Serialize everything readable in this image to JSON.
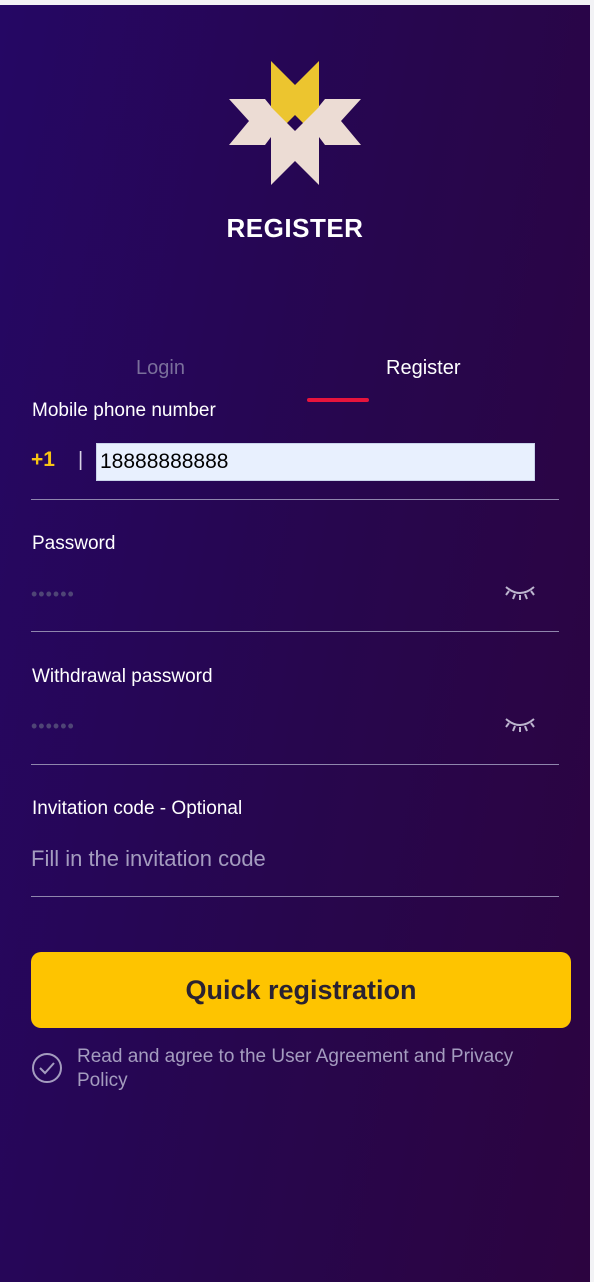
{
  "header": {
    "title": "REGISTER",
    "logo_icon": "star-burst-logo"
  },
  "tabs": [
    {
      "label": "Login",
      "active": false
    },
    {
      "label": "Register",
      "active": true
    }
  ],
  "form": {
    "phone": {
      "label": "Mobile phone number",
      "country_code": "+1",
      "separator": "|",
      "value": "18888888888"
    },
    "password": {
      "label": "Password",
      "placeholder": "••••••",
      "toggle_icon": "eye-closed-icon"
    },
    "withdrawal_password": {
      "label": "Withdrawal password",
      "placeholder": "••••••",
      "toggle_icon": "eye-closed-icon"
    },
    "invitation": {
      "label": "Invitation code - Optional",
      "placeholder": "Fill in the invitation code"
    }
  },
  "submit": {
    "label": "Quick registration"
  },
  "agreement": {
    "text": "Read and agree to the User Agreement and Privacy Policy",
    "checked": true,
    "icon": "check-circle-icon"
  },
  "colors": {
    "accent_yellow": "#fec400",
    "tab_underline": "#e8143c",
    "bg_start": "#250764",
    "bg_end": "#2c0440"
  }
}
